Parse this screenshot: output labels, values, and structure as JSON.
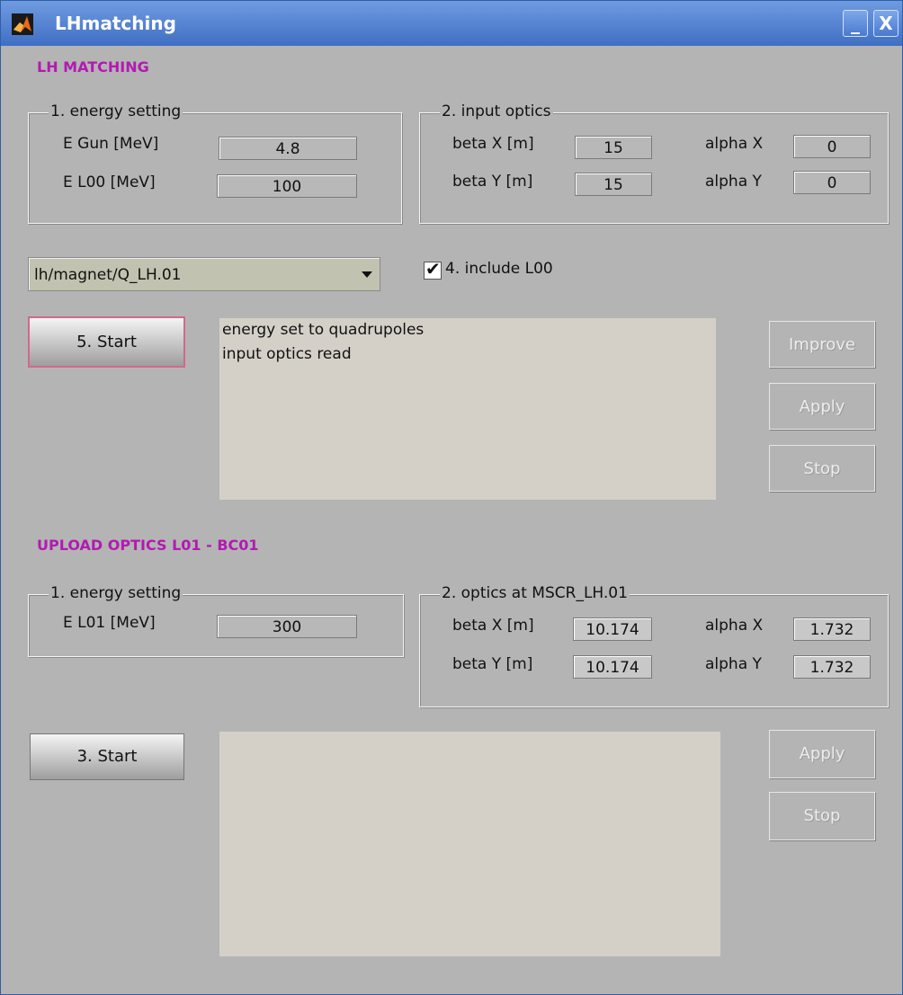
{
  "window": {
    "title": "LHmatching",
    "minimize_label": "_",
    "close_label": "X"
  },
  "lh_matching": {
    "title": "LH MATCHING",
    "energy": {
      "legend": "1. energy setting",
      "egun_label": "E Gun [MeV]",
      "egun_value": "4.8",
      "el00_label": "E L00 [MeV]",
      "el00_value": "100"
    },
    "optics": {
      "legend": "2. input optics",
      "betax_label": "beta X [m]",
      "betax_value": "15",
      "betay_label": "beta Y [m]",
      "betay_value": "15",
      "alphax_label": "alpha X",
      "alphax_value": "0",
      "alphay_label": "alpha Y",
      "alphay_value": "0"
    },
    "dropdown_value": "lh/magnet/Q_LH.01",
    "include_label": "4. include L00",
    "include_checked": true,
    "start_label": "5. Start",
    "log_lines": [
      "energy set to quadrupoles",
      "input optics read"
    ],
    "improve_label": "Improve",
    "apply_label": "Apply",
    "stop_label": "Stop"
  },
  "upload": {
    "title": "UPLOAD OPTICS L01 - BC01",
    "energy": {
      "legend": "1. energy setting",
      "el01_label": "E L01 [MeV]",
      "el01_value": "300"
    },
    "optics": {
      "legend": "2. optics at MSCR_LH.01",
      "betax_label": "beta X [m]",
      "betax_value": "10.174",
      "betay_label": "beta Y [m]",
      "betay_value": "10.174",
      "alphax_label": "alpha X",
      "alphax_value": "1.732",
      "alphay_label": "alpha Y",
      "alphay_value": "1.732"
    },
    "start_label": "3. Start",
    "apply_label": "Apply",
    "stop_label": "Stop"
  }
}
